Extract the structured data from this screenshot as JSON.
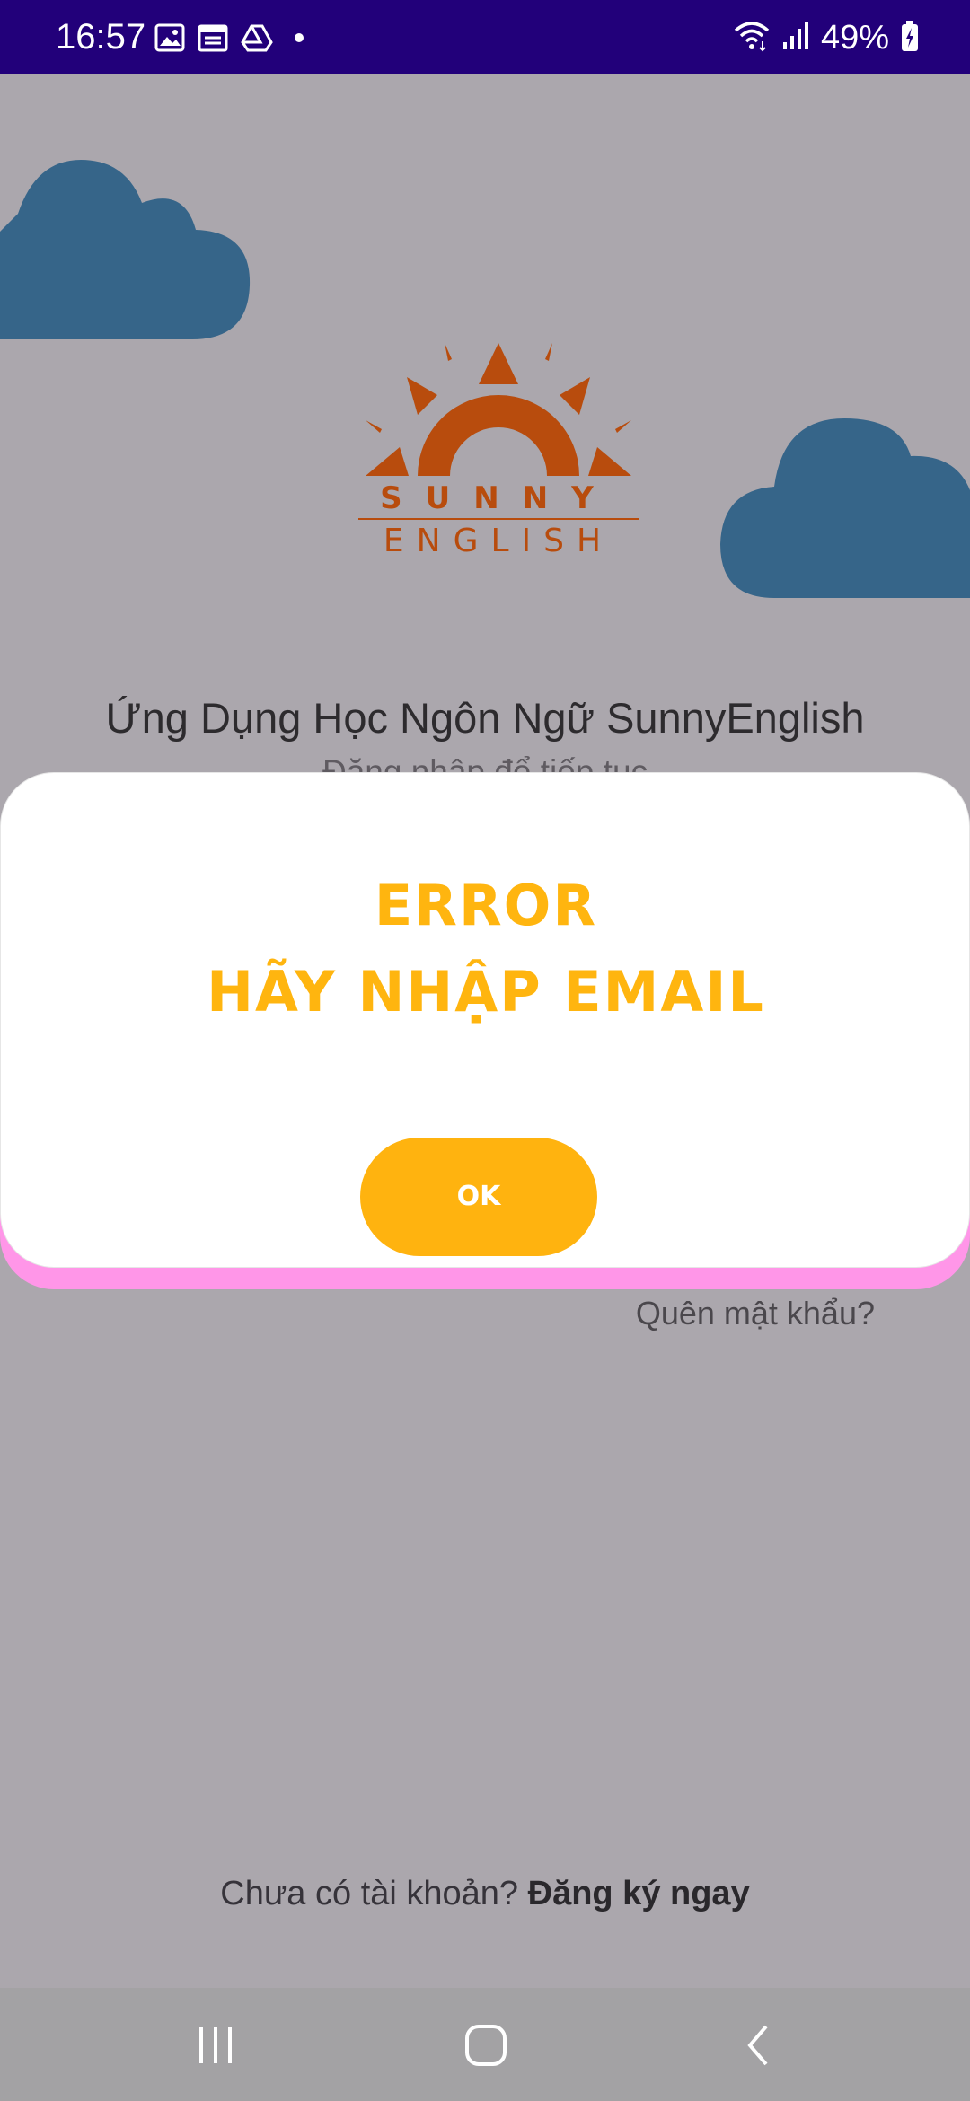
{
  "status_bar": {
    "time": "16:57",
    "battery": "49%",
    "icons": [
      "image-icon",
      "calendar-icon",
      "drive-icon",
      "notification-dot",
      "wifi-icon",
      "signal-icon",
      "battery-charging-icon"
    ],
    "background": "#22007a"
  },
  "logo": {
    "word_top": "SUNNY",
    "word_bottom": "ENGLISH",
    "color": "#b84c0d"
  },
  "screen": {
    "title": "Ứng Dụng Học Ngôn Ngữ SunnyEnglish",
    "subtitle": "Đăng nhập để tiếp tục",
    "forgot_password": "Quên mật khẩu?",
    "signup_prompt": "Chưa có tài khoản?",
    "signup_link": "Đăng ký ngay",
    "cloud_color": "#366589",
    "overlay_background": "#aba7ad"
  },
  "dialog": {
    "title_line1": "Error",
    "title_line2": "Hãy nhập email",
    "ok_label": "OK",
    "accent_color": "#ffb30f",
    "shadow_color": "#ff96e8"
  },
  "nav_bar": {
    "buttons": [
      "recent-apps-icon",
      "home-icon",
      "back-icon"
    ]
  }
}
